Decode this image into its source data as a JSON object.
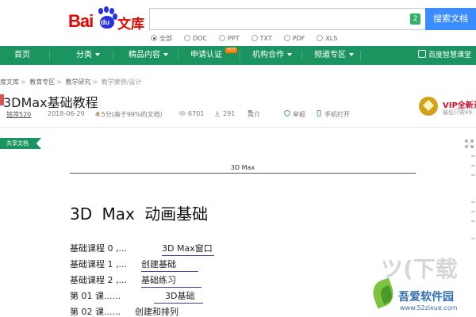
{
  "header": {
    "logo": {
      "bai": "Bai",
      "du": "du",
      "wenku": "文库"
    },
    "search": {
      "count_badge": "2",
      "button_label": "搜索文档"
    },
    "filetypes": [
      {
        "label": "全部",
        "selected": true
      },
      {
        "label": "DOC",
        "selected": false
      },
      {
        "label": "PPT",
        "selected": false
      },
      {
        "label": "TXT",
        "selected": false
      },
      {
        "label": "PDF",
        "selected": false
      },
      {
        "label": "XLS",
        "selected": false
      }
    ]
  },
  "nav": {
    "items": [
      "首页",
      "分类",
      "精品内容",
      "申请认证",
      "机构合作",
      "频道专区"
    ],
    "hot_badge": "HOT",
    "right_label": "百度智慧课堂",
    "bg_color": "#1b9460"
  },
  "breadcrumb": [
    "度文库",
    "教育专区",
    "教学研究",
    "教学案例/设计"
  ],
  "document": {
    "title": "3DMax基础教程",
    "author": "铭萍520",
    "date": "2018-06-29",
    "rating": "4.5分(高于99%的文档)",
    "views": "6701",
    "downloads": "291",
    "intro_label": "简介",
    "report_label": "举报",
    "mobile_label": "手机打开"
  },
  "vip": {
    "title": "VIP全新开",
    "subtitle": "最低只需¥9."
  },
  "share_tag": "共享文档",
  "page": {
    "running_header": "3D Max",
    "heading": "3D Max 动画基础",
    "toc": [
      {
        "label": "基础课程 0 ,...",
        "text": "3D Max窗口"
      },
      {
        "label": "基础课程 1 ,...",
        "text": "创建基础"
      },
      {
        "label": "基础课程 2 ,...",
        "text": "基础练习"
      },
      {
        "label": "第 01 课......",
        "text": "3D基础"
      },
      {
        "label": "第 02 课......",
        "text": "创建和排列"
      }
    ]
  },
  "watermark": {
    "big": "ツ(下载",
    "name": "吾爱软件园",
    "url": "www.52zixue.com"
  }
}
